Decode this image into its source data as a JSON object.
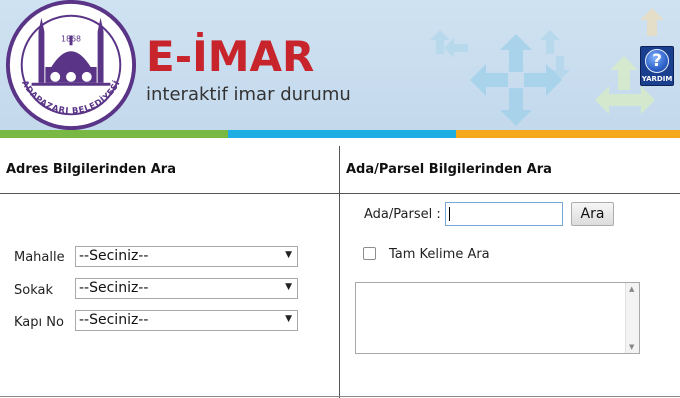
{
  "header": {
    "logo": {
      "year": "1868",
      "ring_text": "ADAPAZARI BELEDİYESİ",
      "icon": "mosque-emblem-icon"
    },
    "brand_title": "E-İMAR",
    "brand_subtitle": "interaktif imar durumu",
    "help_label": "YARDIM",
    "help_icon": "question-mark-icon",
    "colors": {
      "background": "#c9deef",
      "brand_red": "#c8242c",
      "stripe_green": "#78b843",
      "stripe_blue": "#1faee4",
      "stripe_orange": "#f5a81c"
    }
  },
  "address_search": {
    "title": "Adres Bilgilerinden Ara",
    "fields": [
      {
        "label": "Mahalle",
        "selected": "--Seciniz--"
      },
      {
        "label": "Sokak",
        "selected": "--Seciniz--"
      },
      {
        "label": "Kapı No",
        "selected": "--Seciniz--"
      }
    ]
  },
  "parcel_search": {
    "title": "Ada/Parsel Bilgilerinden Ara",
    "input_label": "Ada/Parsel :",
    "input_value": "",
    "search_button": "Ara",
    "exact_match_label": "Tam Kelime Ara",
    "exact_match_checked": false
  }
}
